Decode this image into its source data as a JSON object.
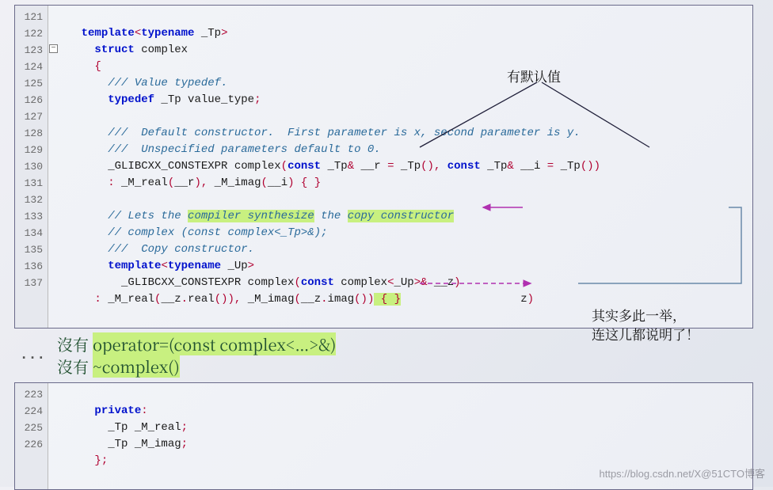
{
  "block1": {
    "lines": [
      "121",
      "122",
      "123",
      "124",
      "125",
      "126",
      "127",
      "128",
      "129",
      "130",
      "131",
      "132",
      "133",
      "134",
      "135",
      "136",
      "137"
    ],
    "code": {
      "l121": {
        "indent": "    ",
        "kw1": "template",
        "p1": "<",
        "kw2": "typename",
        "sp": " _Tp",
        "p2": ">"
      },
      "l122": {
        "indent": "      ",
        "kw": "struct",
        "name": " complex"
      },
      "l123": {
        "indent": "      ",
        "brace": "{"
      },
      "l124": {
        "indent": "        ",
        "cmt": "/// Value typedef."
      },
      "l125": {
        "indent": "        ",
        "kw": "typedef",
        "rest": " _Tp value_type",
        "semi": ";"
      },
      "l127": {
        "indent": "        ",
        "cmt": "///  Default constructor.  First parameter is x, second parameter is y."
      },
      "l128": {
        "indent": "        ",
        "cmt": "///  Unspecified parameters default to 0."
      },
      "l129": {
        "indent": "        ",
        "a": "_GLIBCXX_CONSTEXPR complex",
        "p1": "(",
        "kw1": "const",
        "b": " _Tp",
        "amp1": "&",
        "c": " __r ",
        "eq1": "=",
        "d": " _Tp",
        "p2": "()",
        "com": ",",
        "sp": " ",
        "kw2": "const",
        "e": " _Tp",
        "amp2": "&",
        "f": " __i ",
        "eq2": "=",
        "g": " _Tp",
        "p3": "())"
      },
      "l130": {
        "indent": "        ",
        "col": ":",
        "a": " _M_real",
        "p1": "(",
        "b": "__r",
        "p2": "),",
        "c": " _M_imag",
        "p3": "(",
        "d": "__i",
        "p4": ")",
        "br": " { }"
      },
      "l132": {
        "indent": "        ",
        "c1": "// Lets the ",
        "c2": "compiler synthesize",
        "c3": " the ",
        "c4": "copy constructor"
      },
      "l133": {
        "indent": "        ",
        "cmt": "// complex (const complex<_Tp>&);"
      },
      "l134": {
        "indent": "        ",
        "cmt": "///  Copy constructor."
      },
      "l135": {
        "indent": "        ",
        "kw1": "template",
        "p1": "<",
        "kw2": "typename",
        "sp": " _Up",
        "p2": ">"
      },
      "l136": {
        "indent": "          ",
        "a": "_GLIBCXX_CONSTEXPR complex",
        "p1": "(",
        "kw": "const",
        "b": " complex",
        "lt": "<",
        "c": "_Up",
        "gt": ">&",
        "d": " __z",
        "p2": ")"
      },
      "l137": {
        "indent": "      ",
        "col": ":",
        "a": " _M_real",
        "p1": "(",
        "b": "__z",
        "dot1": ".",
        "c": "real",
        "p2": "()),",
        "d": " _M_imag",
        "p3": "(",
        "e": "__z",
        "dot2": ".",
        "f": "imag",
        "p4": "())",
        "hlbr": " { }",
        "tail_z": "z",
        "tail_p": ")"
      }
    }
  },
  "middle": {
    "ellipsis": "...",
    "line1a": "沒有 ",
    "line1b": "operator=(const complex<…>&)",
    "line2a": "沒有 ",
    "line2b": "~complex()"
  },
  "block2": {
    "lines": [
      "223",
      "224",
      "225",
      "226"
    ],
    "code": {
      "l223": {
        "indent": "      ",
        "kw": "private",
        "col": ":"
      },
      "l224": {
        "indent": "        ",
        "a": "_Tp _M_real",
        "semi": ";"
      },
      "l225": {
        "indent": "        ",
        "a": "_Tp _M_imag",
        "semi": ";"
      },
      "l226": {
        "indent": "      ",
        "br": "};"
      }
    }
  },
  "annotations": {
    "top": "有默认值",
    "right1": "其实多此一举，",
    "right2": "连这儿都说明了！"
  },
  "fold_mark": "−",
  "watermark": "https://blog.csdn.net/X@51CTO博客"
}
